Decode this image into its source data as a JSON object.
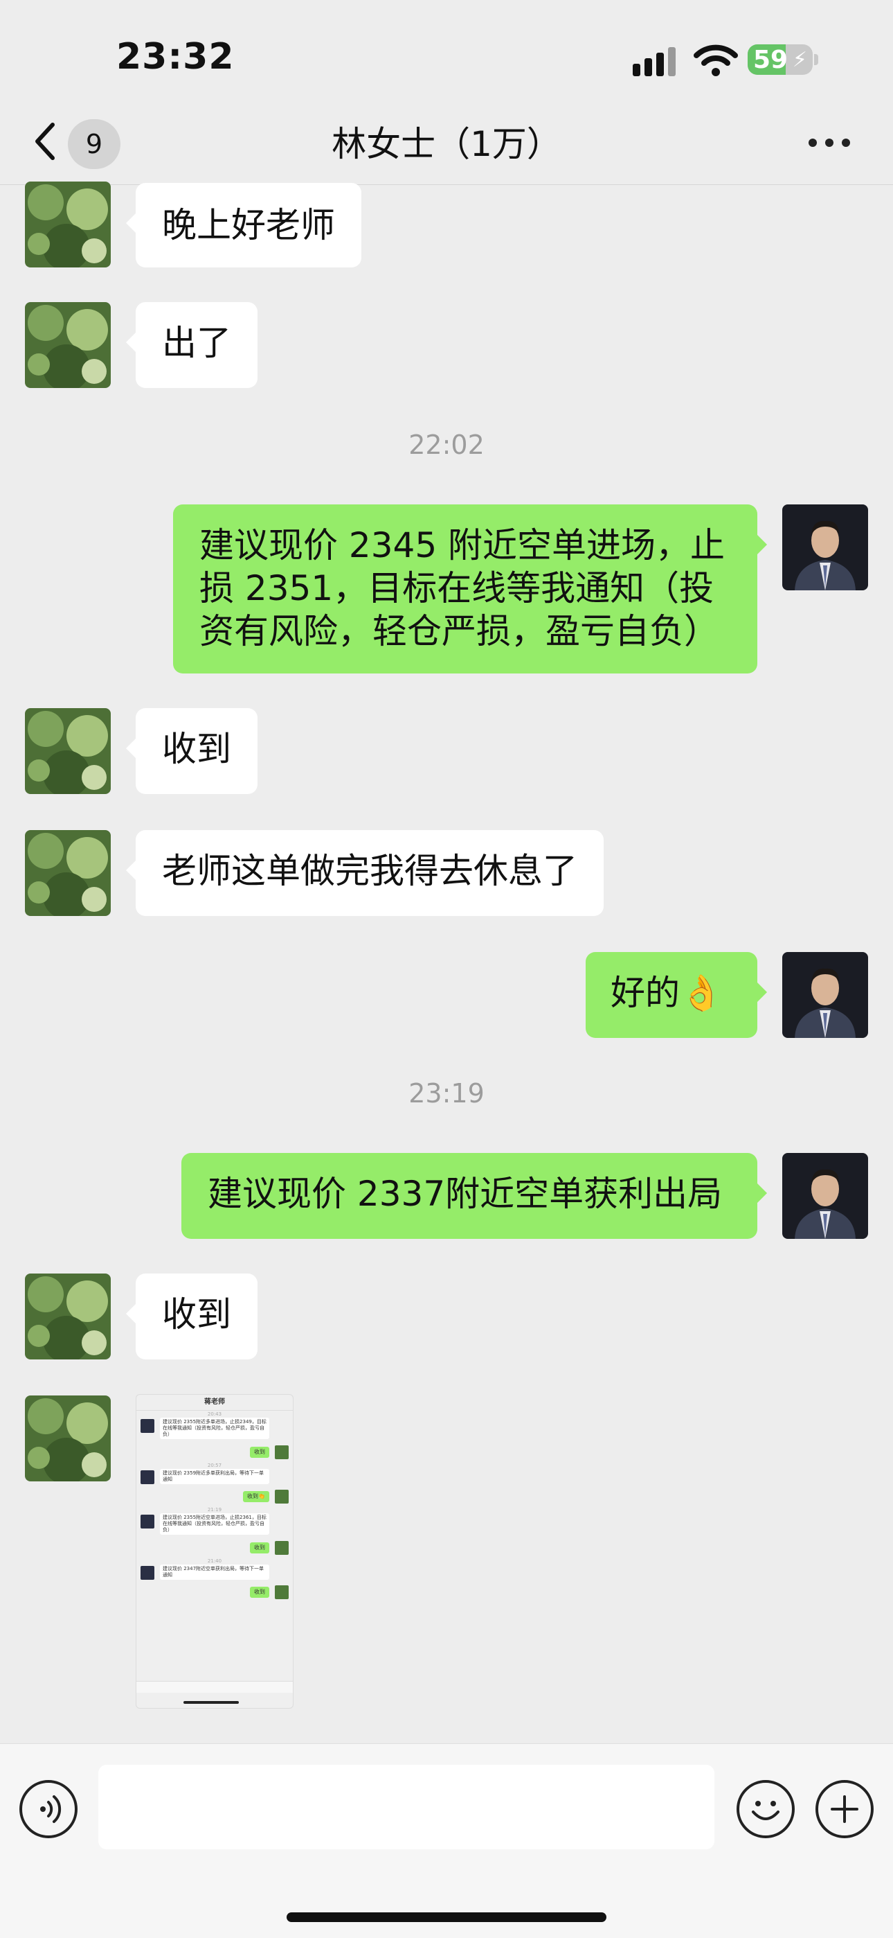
{
  "status_bar": {
    "time": "23:32",
    "battery": "59",
    "battery_level": 0.59
  },
  "header": {
    "unread_count": "9",
    "title": "林女士（1万）"
  },
  "messages": [
    {
      "side": "left",
      "text": "晚上好老师"
    },
    {
      "side": "left",
      "text": "出了"
    },
    {
      "timestamp": "22:02"
    },
    {
      "side": "right",
      "text_lines": [
        "建议现价 2345 附近空单进场，止",
        "损 2351，目标在线等我通知（投",
        "资有风险，轻仓严损，盈亏自负）"
      ]
    },
    {
      "side": "left",
      "text": "收到"
    },
    {
      "side": "left",
      "text": "老师这单做完我得去休息了"
    },
    {
      "side": "right",
      "text": "好的👌"
    },
    {
      "timestamp": "23:19"
    },
    {
      "side": "right",
      "text": "建议现价 2337附近空单获利出局"
    },
    {
      "side": "left",
      "text": "收到"
    },
    {
      "side": "left",
      "type": "image"
    }
  ],
  "thumbnail": {
    "title": "蒋老师",
    "entries": [
      {
        "time": "20:43",
        "msg": "建议现价 2355附近多单进场，止损2349，目标在线等我通知（投资有风险，轻仓严损，盈亏自负）",
        "reply": "收到"
      },
      {
        "time": "20:57",
        "msg": "建议现价 2359附近多单获利出局，等待下一单通知",
        "reply": "收到👏"
      },
      {
        "time": "21:19",
        "msg": "建议现价 2355附近空单进场，止损2361，目标在线等我通知（投资有风险，轻仓严损，盈亏自负）",
        "reply": "收到"
      },
      {
        "time": "21:40",
        "msg": "建议现价 2347附近空单获利出局，等待下一单通知",
        "reply": "收到"
      }
    ]
  }
}
